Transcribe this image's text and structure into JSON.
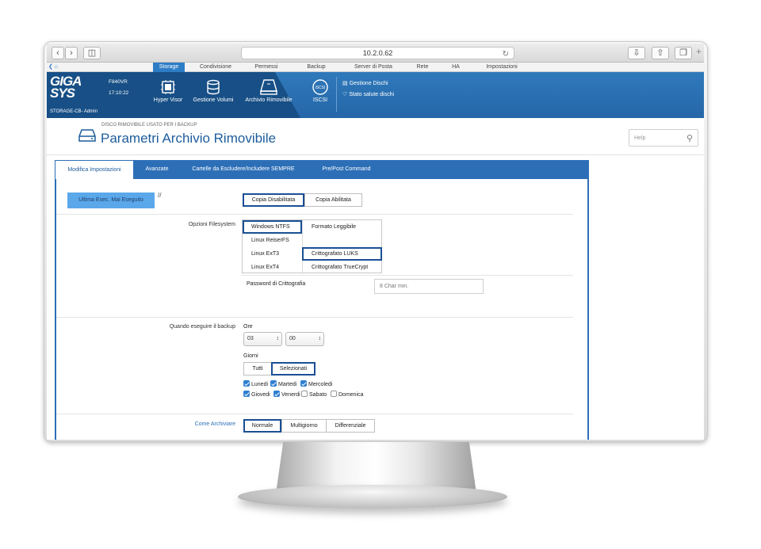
{
  "browser": {
    "url": "10.2.0.62"
  },
  "menubar": {
    "items": [
      "Storage",
      "Condivisione",
      "Permessi",
      "Backup",
      "Server di Posta",
      "Rete",
      "HA",
      "Impostazioni"
    ]
  },
  "header": {
    "logo_line1": "GIGA",
    "logo_line2": "SYS",
    "user": "STORAGE-CB-  Admin",
    "model": "F840VR",
    "time": "17:10:22",
    "buttons": [
      "Hyper Visor",
      "Gestione Volumi",
      "Archivio Rimovibile",
      "ISCSI"
    ],
    "links": [
      "Gestione Dischi",
      "Stato salute dischi"
    ]
  },
  "page": {
    "subtitle": "DISCO RIMOVIBILE USATO PER I BACKUP",
    "title": "Parametri Archivio Rimovibile",
    "help_placeholder": "Help"
  },
  "tabs": [
    "Modifica Impostazioni",
    "Avanzate",
    "Cartelle da Escludere/Includere SEMPRE",
    "Pre/Post Command"
  ],
  "form": {
    "last_run": "Ultima Esec. Mai Eseguito",
    "slashes": "//",
    "copy_options": [
      "Copia Disabilitata",
      "Copia Abilitata"
    ],
    "fs_label": "Opzioni Filesystem",
    "fs_col1": [
      "Windows NTFS",
      "Linux ReiserFS",
      "Linux ExT3",
      "Linux ExT4"
    ],
    "fs_col2": [
      "Formato Leggibile",
      "Crittografato LUKS",
      "Crittografato TrueCrypt"
    ],
    "pwd_label": "Password di Crittografia",
    "pwd_placeholder": "8 Char min.",
    "when_label": "Quando eseguire il backup",
    "hours_label": "Ore",
    "hour": "03",
    "minute": "00",
    "days_label": "Giorni",
    "days_mode": [
      "Tutti",
      "Selezionati"
    ],
    "days": [
      {
        "name": "Lunedi",
        "checked": true
      },
      {
        "name": "Martedi",
        "checked": true
      },
      {
        "name": "Mercoledi",
        "checked": true
      },
      {
        "name": "Giovedi",
        "checked": true
      },
      {
        "name": "Venerdi",
        "checked": true
      },
      {
        "name": "Sabato",
        "checked": false
      },
      {
        "name": "Domenica",
        "checked": false
      }
    ],
    "archive_label": "Come Archiviare",
    "archive_modes": [
      "Normale",
      "Multigiorno",
      "Differenziale"
    ]
  },
  "colors": {
    "accent": "#2d6fb7",
    "header": "#2a70b3",
    "selected_border": "#1a4f94"
  }
}
